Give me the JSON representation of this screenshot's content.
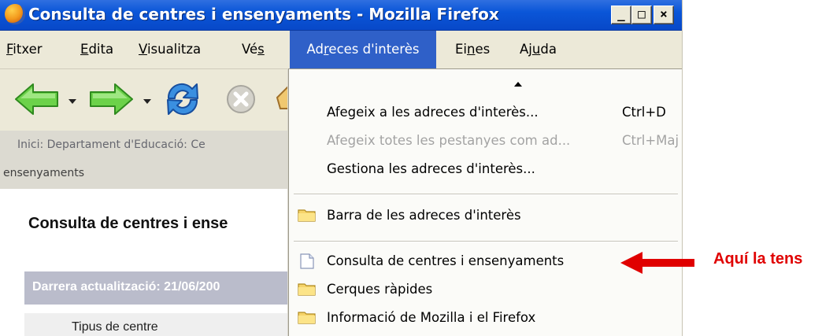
{
  "window": {
    "title": "Consulta de centres i ensenyaments - Mozilla Firefox",
    "minimize": "_",
    "maximize": "□",
    "close": "×"
  },
  "menubar": {
    "items": [
      {
        "pre": "",
        "u": "F",
        "post": "itxer"
      },
      {
        "pre": "",
        "u": "E",
        "post": "dita"
      },
      {
        "pre": "",
        "u": "V",
        "post": "isualitza"
      },
      {
        "pre": "Vé",
        "u": "s",
        "post": ""
      },
      {
        "pre": "Ad",
        "u": "r",
        "post": "eces d'interès"
      },
      {
        "pre": "Ei",
        "u": "n",
        "post": "es"
      },
      {
        "pre": "Aj",
        "u": "u",
        "post": "da"
      }
    ]
  },
  "navbar": {
    "icons": [
      "back-arrow-icon",
      "dropdown-arrow-icon",
      "forward-arrow-icon",
      "reload-icon",
      "stop-icon",
      "home-icon"
    ]
  },
  "breadcrumb": {
    "line1": "Inici: Departament d'Educació: Ce",
    "line2": "ensenyaments"
  },
  "content": {
    "heading": "Consulta de centres i ense",
    "update": "Darrera actualització: 21/06/200",
    "type_label": "Tipus de centre"
  },
  "bookmarks_menu": {
    "add": {
      "label": "Afegeix a les adreces d'interès...",
      "shortcut": "Ctrl+D"
    },
    "add_all": {
      "label": "Afegeix totes les pestanyes com ad...",
      "shortcut": "Ctrl+Maj"
    },
    "manage": {
      "label": "Gestiona les adreces d'interès..."
    },
    "toolbar_folder": {
      "label": "Barra de les adreces d'interès",
      "icon": "folder-icon"
    },
    "bookmark": {
      "label": "Consulta de centres i ensenyaments",
      "icon": "page-icon"
    },
    "quick_searches": {
      "label": "Cerques ràpides",
      "icon": "folder-icon"
    },
    "mozilla_info": {
      "label": "Informació de Mozilla i el Firefox",
      "icon": "folder-icon"
    }
  },
  "annotation": {
    "text": "Aquí la tens",
    "color": "#e00000"
  },
  "colors": {
    "menu_highlight": "#2f60c8",
    "titlebar": "#0a56d8"
  }
}
